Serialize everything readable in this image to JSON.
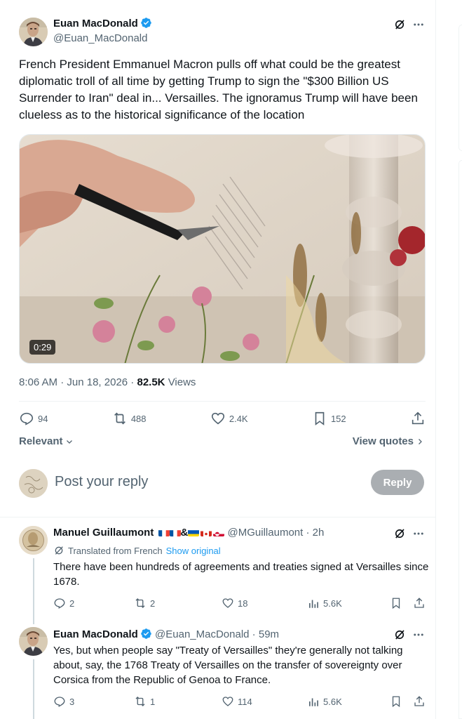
{
  "post": {
    "author_name": "Euan MacDonald",
    "author_handle": "@Euan_MacDonald",
    "text": "French President Emmanuel Macron pulls off what could be the greatest diplomatic troll of all time by getting Trump to sign the \"$300 Billion US Surrender to Iran\" deal in... Versailles. The ignoramus Trump will have been clueless as to the historical significance of the location",
    "video_duration": "0:29",
    "time": "8:06 AM",
    "date": "Jun 18, 2026",
    "views_count": "82.5K",
    "views_label": "Views",
    "replies": "94",
    "reposts": "488",
    "likes": "2.4K",
    "bookmarks": "152"
  },
  "sort": {
    "relevant_label": "Relevant",
    "view_quotes_label": "View quotes"
  },
  "reply_box": {
    "placeholder": "Post your reply",
    "button_label": "Reply"
  },
  "replies": [
    {
      "author_name": "Manuel Guillaumont",
      "flags_text": "&",
      "author_handle": "@MGuillaumont",
      "age": "2h",
      "translated_label": "Translated from French",
      "show_original_label": "Show original",
      "text": "There have been hundreds of agreements and treaties signed at Versailles since 1678.",
      "replies": "2",
      "reposts": "2",
      "likes": "18",
      "views": "5.6K"
    },
    {
      "author_name": "Euan MacDonald",
      "author_handle": "@Euan_MacDonald",
      "age": "59m",
      "text": "Yes, but when people say \"Treaty of Versailles\" they're generally not talking about, say, the 1768 Treaty of Versailles on the transfer of sovereignty over Corsica from the Republic of Genoa to France.",
      "replies": "3",
      "reposts": "1",
      "likes": "114",
      "views": "5.6K"
    }
  ],
  "colors": {
    "verified_blue": "#1d9bf0",
    "secondary_text": "#536471",
    "link_blue": "#1d9bf0"
  },
  "icons": [
    "verified-badge-icon",
    "grok-icon",
    "more-icon",
    "reply-icon",
    "repost-icon",
    "like-icon",
    "bookmark-icon",
    "share-icon",
    "views-icon",
    "chevron-down-icon",
    "chevron-right-icon",
    "translate-icon"
  ]
}
